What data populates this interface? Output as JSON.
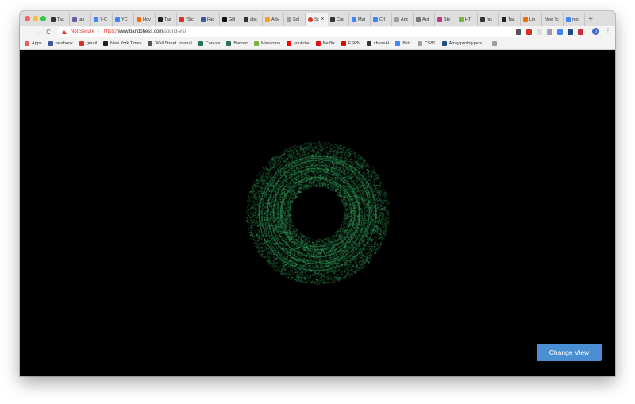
{
  "tabs": [
    {
      "title": "Tas",
      "icon": "github-icon",
      "color": "#333333"
    },
    {
      "title": "tas",
      "icon": "heroku-icon",
      "color": "#6762a6"
    },
    {
      "title": "Y-C",
      "icon": "doc-icon",
      "color": "#4285f4"
    },
    {
      "title": "YC",
      "icon": "doc-icon",
      "color": "#4285f4"
    },
    {
      "title": "Hov",
      "icon": "ycombinator-icon",
      "color": "#ff6600"
    },
    {
      "title": "Tas",
      "icon": "generic-icon",
      "color": "#222222"
    },
    {
      "title": "*Sic",
      "icon": "gmail-icon",
      "color": "#d93025"
    },
    {
      "title": "Fac",
      "icon": "facebook-icon",
      "color": "#3b5998"
    },
    {
      "title": "Glit",
      "icon": "notion-icon",
      "color": "#111111"
    },
    {
      "title": "abc",
      "icon": "github-icon",
      "color": "#333333"
    },
    {
      "title": "Adv",
      "icon": "leetcode-icon",
      "color": "#f89f1b"
    },
    {
      "title": "Sol",
      "icon": "page-icon",
      "color": "#9aa0a6"
    },
    {
      "title": "Sc",
      "icon": "recording-icon",
      "color": "#d93025",
      "active": true
    },
    {
      "title": "Coc",
      "icon": "github-icon",
      "color": "#333333"
    },
    {
      "title": "Mai",
      "icon": "docs-icon",
      "color": "#4285f4"
    },
    {
      "title": "Crl",
      "icon": "docs-icon",
      "color": "#4285f4"
    },
    {
      "title": "Anc",
      "icon": "page-icon",
      "color": "#9aa0a6"
    },
    {
      "title": "Aut",
      "icon": "generic-icon",
      "color": "#777777"
    },
    {
      "title": "Ste",
      "icon": "instagram-icon",
      "color": "#c13584"
    },
    {
      "title": "HTi",
      "icon": "html-icon",
      "color": "#7cb342"
    },
    {
      "title": "fac",
      "icon": "github-icon",
      "color": "#333333"
    },
    {
      "title": "Tas",
      "icon": "generic-icon",
      "color": "#222222"
    },
    {
      "title": "Lin",
      "icon": "flag-icon",
      "color": "#e8710a"
    },
    {
      "title": "New Tc",
      "icon": "none",
      "color": "transparent"
    },
    {
      "title": "mo",
      "icon": "google-icon",
      "color": "#4285f4"
    }
  ],
  "toolbar": {
    "back": "←",
    "forward": "→",
    "reload": "C",
    "not_secure": "Not Secure",
    "url_scheme": "https://",
    "url_host": "www.bandohess.com",
    "url_path": "/sound-vis/",
    "star": "☆",
    "profile_initial": "o",
    "menu": "⋮"
  },
  "extensions": [
    {
      "name": "cast-icon",
      "color": "#555555"
    },
    {
      "name": "opera-icon",
      "color": "#d93025"
    },
    {
      "name": "blank-ext-icon",
      "color": "#dddddd"
    },
    {
      "name": "grid-ext-icon",
      "color": "#9e9e9e"
    },
    {
      "name": "timer-ext-icon",
      "color": "#4285f4"
    },
    {
      "name": "zotero-icon",
      "color": "#1a4f8b"
    },
    {
      "name": "lastpass-icon",
      "color": "#cc2a36"
    }
  ],
  "bookmarks": [
    {
      "label": "Apps",
      "icon": "apps-icon",
      "color": "#e0655a"
    },
    {
      "label": "facebook",
      "icon": "facebook-icon",
      "color": "#3b5998"
    },
    {
      "label": "gmail",
      "icon": "gmail-icon",
      "color": "#d93025"
    },
    {
      "label": "New York Times",
      "icon": "nyt-icon",
      "color": "#222222"
    },
    {
      "label": "Wall Street Journal",
      "icon": "wsj-icon",
      "color": "#555555"
    },
    {
      "label": "Canvas",
      "icon": "canvas-icon",
      "color": "#2e6f5a"
    },
    {
      "label": "Banner",
      "icon": "banner-icon",
      "color": "#2e6f5a"
    },
    {
      "label": "Mascoma",
      "icon": "mascoma-icon",
      "color": "#7cb342"
    },
    {
      "label": "youtube",
      "icon": "youtube-icon",
      "color": "#ff0000"
    },
    {
      "label": "Netflix",
      "icon": "netflix-icon",
      "color": "#e50914"
    },
    {
      "label": "ESPN",
      "icon": "espn-icon",
      "color": "#d50a0a"
    },
    {
      "label": "chessAI",
      "icon": "github-icon",
      "color": "#333333"
    },
    {
      "label": "Blitz",
      "icon": "docs-icon",
      "color": "#4285f4"
    },
    {
      "label": "CS81",
      "icon": "page-icon",
      "color": "#9aa0a6"
    },
    {
      "label": "Array.prototype.s...",
      "icon": "mdn-icon",
      "color": "#1f4f7a"
    },
    {
      "label": "",
      "icon": "page-icon",
      "color": "#9aa0a6"
    }
  ],
  "page": {
    "change_view_label": "Change View"
  },
  "colors": {
    "visualization": "#3dbb6e",
    "button": "#4a8fd4",
    "background": "#000000"
  }
}
